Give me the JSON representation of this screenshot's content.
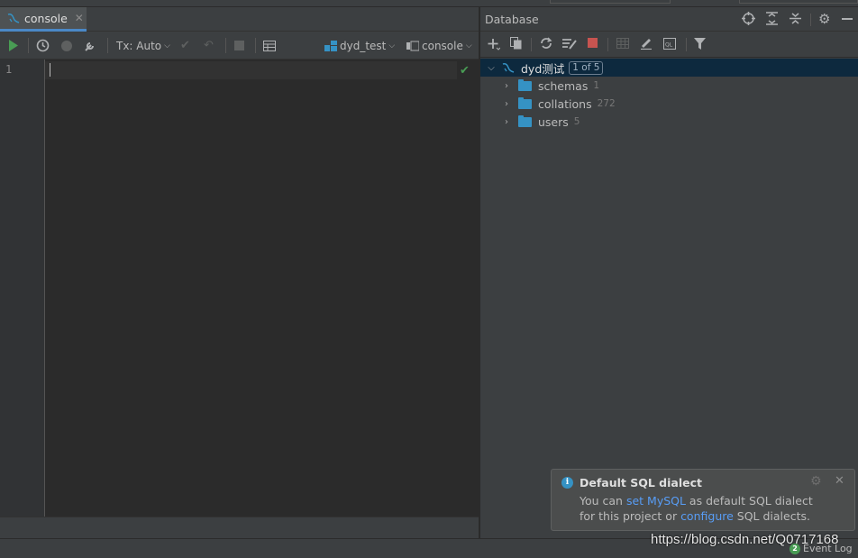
{
  "editor": {
    "tab_label": "console",
    "line_number": "1",
    "toolbar": {
      "tx_label": "Tx: Auto",
      "datasource_label": "dyd_test",
      "session_label": "console"
    }
  },
  "database_panel": {
    "title": "Database",
    "tree": {
      "root": {
        "name": "dyd测试",
        "badge": "1 of 5"
      },
      "items": [
        {
          "name": "schemas",
          "count": "1"
        },
        {
          "name": "collations",
          "count": "272"
        },
        {
          "name": "users",
          "count": "5"
        }
      ]
    }
  },
  "notification": {
    "title": "Default SQL dialect",
    "line1_prefix": "You can ",
    "line1_link": "set MySQL",
    "line1_suffix": " as default SQL dialect",
    "line2_prefix": "for this project or ",
    "line2_link": "configure",
    "line2_suffix": " SQL dialects."
  },
  "status": {
    "event_log_label": "Event Log",
    "event_log_count": "2"
  },
  "watermark": "https://blog.csdn.net/Q0717168",
  "colors": {
    "accent": "#4a88c7",
    "folder": "#3592c4",
    "run_green": "#499c54",
    "stop_red": "#c75450",
    "link": "#589df6"
  }
}
